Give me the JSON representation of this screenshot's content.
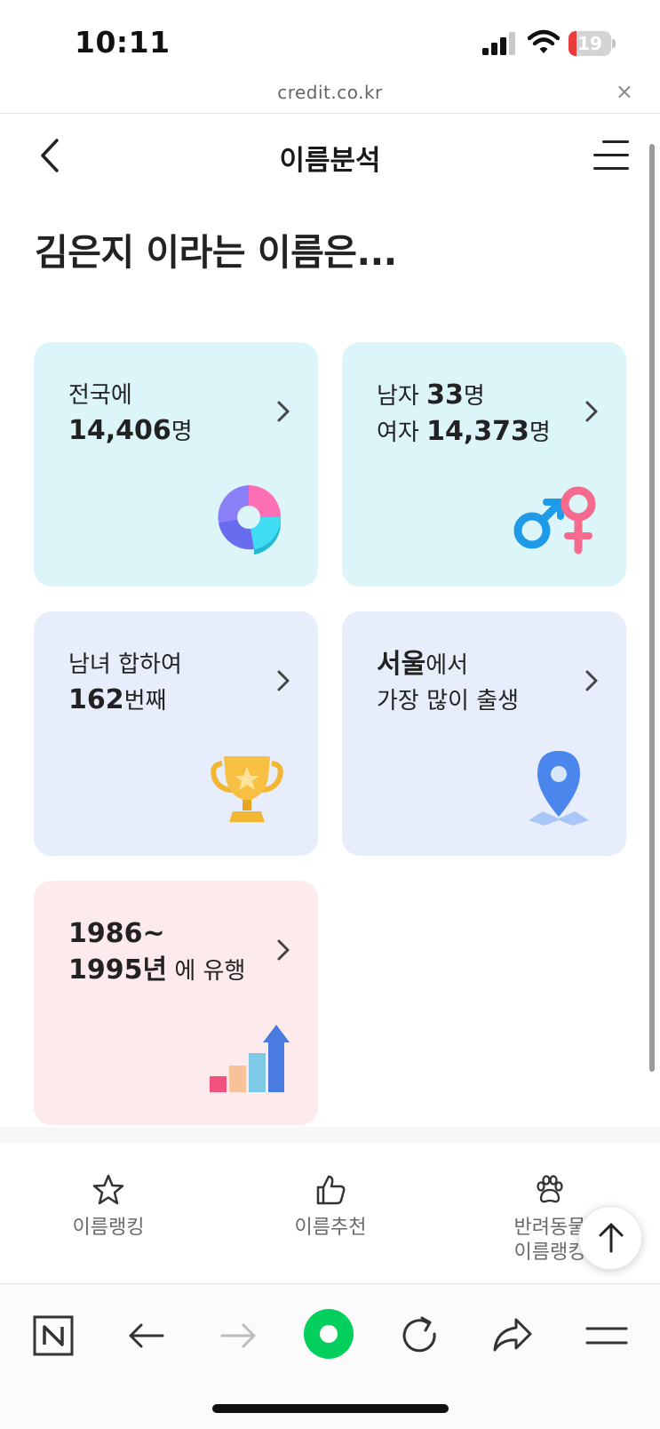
{
  "status_bar": {
    "time": "10:11",
    "battery_level": "19",
    "battery_fraction": 0.19
  },
  "browser": {
    "url": "credit.co.kr",
    "close_label": "×"
  },
  "header": {
    "title": "이름분석"
  },
  "headline": "김은지 이라는 이름은...",
  "cards": {
    "population": {
      "line1": "전국에",
      "count": "14,406",
      "unit": "명"
    },
    "gender": {
      "male_label": "남자 ",
      "male_count": "33",
      "male_unit": "명",
      "female_label": "여자 ",
      "female_count": "14,373",
      "female_unit": "명"
    },
    "rank": {
      "line1": "남녀 합하여",
      "rank": "162",
      "unit": "번째"
    },
    "region": {
      "region": "서울",
      "suffix": "에서",
      "line2": "가장 많이 출생"
    },
    "era": {
      "start": "1986~",
      "end": "1995년",
      "suffix": " 에 유행"
    }
  },
  "bottom_tabs": [
    {
      "label": "이름랭킹",
      "icon": "star-icon"
    },
    {
      "label": "이름추천",
      "icon": "thumbs-up-icon"
    },
    {
      "label_line1": "반려동물",
      "label_line2": "이름랭킹",
      "icon": "paw-icon"
    }
  ],
  "toolbar_icons": [
    "naver-n-icon",
    "back-arrow-icon",
    "forward-arrow-icon",
    "green-dot-icon",
    "reload-icon",
    "share-icon",
    "menu-icon"
  ],
  "colors": {
    "card_cyan": "#dcf5f9",
    "card_lavender": "#e8edfc",
    "card_pink": "#fdeaec",
    "naver_green": "#03cf5d",
    "battery_red": "#ea3c3a"
  }
}
